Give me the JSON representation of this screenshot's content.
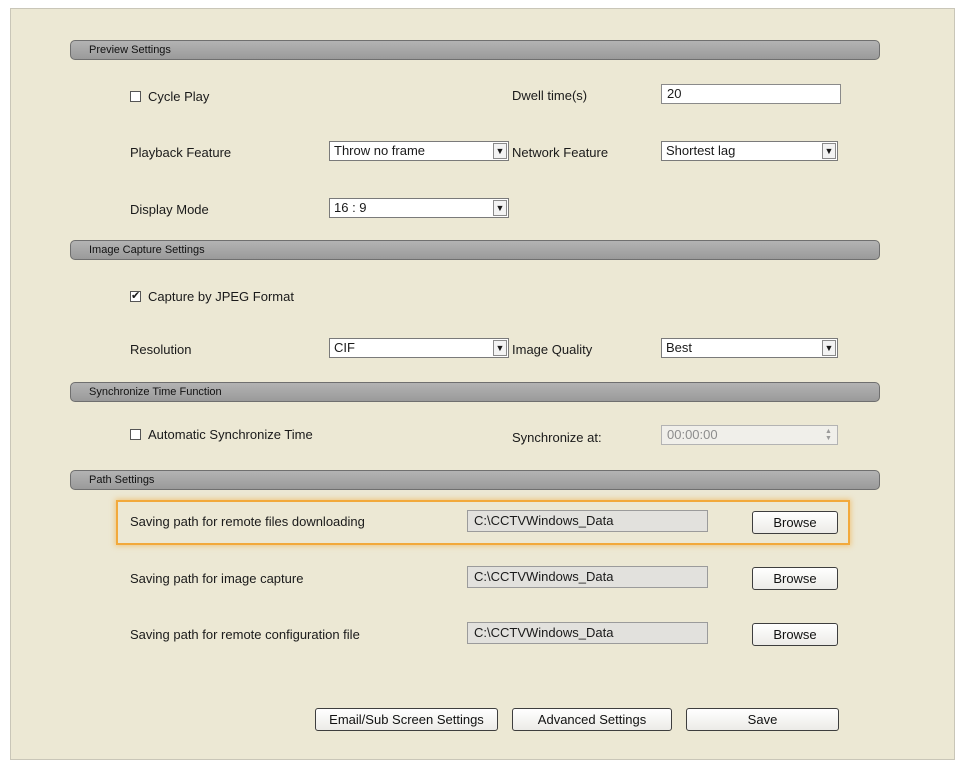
{
  "preview": {
    "header": "Preview Settings",
    "cycle_play": {
      "label": "Cycle Play",
      "checked": false
    },
    "dwell_label": "Dwell time(s)",
    "dwell_value": "20",
    "playback_label": "Playback Feature",
    "playback_value": "Throw no frame",
    "network_label": "Network Feature",
    "network_value": "Shortest lag",
    "display_label": "Display Mode",
    "display_value": "16 : 9"
  },
  "capture": {
    "header": "Image Capture Settings",
    "jpeg": {
      "label": "Capture by JPEG Format",
      "checked": true
    },
    "resolution_label": "Resolution",
    "resolution_value": "CIF",
    "quality_label": "Image Quality",
    "quality_value": "Best"
  },
  "sync": {
    "header": "Synchronize Time Function",
    "auto": {
      "label": "Automatic Synchronize Time",
      "checked": false
    },
    "at_label": "Synchronize at:",
    "at_value": "00:00:00"
  },
  "paths": {
    "header": "Path Settings",
    "browse_label": "Browse",
    "rows": [
      {
        "label": "Saving path for remote files downloading",
        "value": "C:\\CCTVWindows_Data"
      },
      {
        "label": "Saving path for image capture",
        "value": "C:\\CCTVWindows_Data"
      },
      {
        "label": "Saving path for remote configuration file",
        "value": "C:\\CCTVWindows_Data"
      }
    ]
  },
  "footer": {
    "email": "Email/Sub Screen Settings",
    "advanced": "Advanced Settings",
    "save": "Save"
  },
  "colors": {
    "panel": "#ece8d4",
    "section_header": "#a6a6a6",
    "highlight": "#f2a93b"
  }
}
